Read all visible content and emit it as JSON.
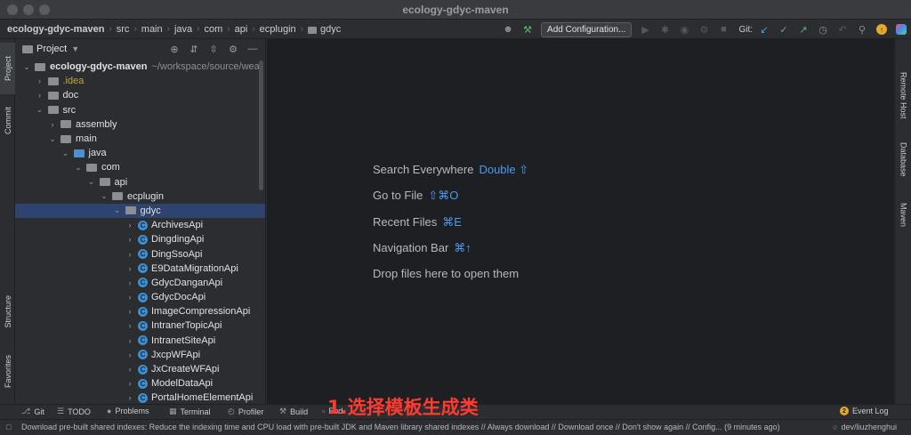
{
  "window": {
    "title": "ecology-gdyc-maven"
  },
  "breadcrumb": [
    "ecology-gdyc-maven",
    "src",
    "main",
    "java",
    "com",
    "api",
    "ecplugin",
    "gdyc"
  ],
  "toolbar": {
    "add_configuration": "Add Configuration...",
    "git_label": "Git:"
  },
  "left_tabs": {
    "project": "Project",
    "commit": "Commit",
    "structure": "Structure",
    "favorites": "Favorites"
  },
  "right_tabs": {
    "remote_host": "Remote Host",
    "database": "Database",
    "maven": "Maven"
  },
  "project_panel": {
    "title": "Project",
    "tree": [
      {
        "label": "ecology-gdyc-maven",
        "path": "~/workspace/source/wea",
        "depth": 0,
        "expanded": true,
        "kind": "module"
      },
      {
        "label": ".idea",
        "depth": 1,
        "expanded": false,
        "kind": "folder"
      },
      {
        "label": "doc",
        "depth": 1,
        "expanded": false,
        "kind": "folder"
      },
      {
        "label": "src",
        "depth": 1,
        "expanded": true,
        "kind": "folder"
      },
      {
        "label": "assembly",
        "depth": 2,
        "expanded": false,
        "kind": "folder"
      },
      {
        "label": "main",
        "depth": 2,
        "expanded": true,
        "kind": "folder"
      },
      {
        "label": "java",
        "depth": 3,
        "expanded": true,
        "kind": "source"
      },
      {
        "label": "com",
        "depth": 4,
        "expanded": true,
        "kind": "package"
      },
      {
        "label": "api",
        "depth": 5,
        "expanded": true,
        "kind": "package"
      },
      {
        "label": "ecplugin",
        "depth": 6,
        "expanded": true,
        "kind": "package"
      },
      {
        "label": "gdyc",
        "depth": 7,
        "expanded": true,
        "kind": "package",
        "selected": true
      },
      {
        "label": "ArchivesApi",
        "depth": 8,
        "expanded": false,
        "kind": "class"
      },
      {
        "label": "DingdingApi",
        "depth": 8,
        "expanded": false,
        "kind": "class"
      },
      {
        "label": "DingSsoApi",
        "depth": 8,
        "expanded": false,
        "kind": "class"
      },
      {
        "label": "E9DataMigrationApi",
        "depth": 8,
        "expanded": false,
        "kind": "class"
      },
      {
        "label": "GdycDanganApi",
        "depth": 8,
        "expanded": false,
        "kind": "class"
      },
      {
        "label": "GdycDocApi",
        "depth": 8,
        "expanded": false,
        "kind": "class"
      },
      {
        "label": "ImageCompressionApi",
        "depth": 8,
        "expanded": false,
        "kind": "class"
      },
      {
        "label": "IntranerTopicApi",
        "depth": 8,
        "expanded": false,
        "kind": "class"
      },
      {
        "label": "IntranetSiteApi",
        "depth": 8,
        "expanded": false,
        "kind": "class"
      },
      {
        "label": "JxcpWFApi",
        "depth": 8,
        "expanded": false,
        "kind": "class"
      },
      {
        "label": "JxCreateWFApi",
        "depth": 8,
        "expanded": false,
        "kind": "class"
      },
      {
        "label": "ModelDataApi",
        "depth": 8,
        "expanded": false,
        "kind": "class"
      },
      {
        "label": "PortalHomeElementApi",
        "depth": 8,
        "expanded": false,
        "kind": "class"
      }
    ]
  },
  "editor_hints": [
    {
      "text": "Search Everywhere",
      "key": "Double ⇧"
    },
    {
      "text": "Go to File",
      "key": "⇧⌘O"
    },
    {
      "text": "Recent Files",
      "key": "⌘E"
    },
    {
      "text": "Navigation Bar",
      "key": "⌘↑"
    },
    {
      "text": "Drop files here to open them",
      "key": ""
    }
  ],
  "bottom_tabs": {
    "git": "Git",
    "todo": "TODO",
    "problems": "Problems",
    "terminal": "Terminal",
    "profiler": "Profiler",
    "build": "Build",
    "endpoints": "End",
    "event_log": "Event Log",
    "event_count": "2"
  },
  "status": {
    "message": "Download pre-built shared indexes: Reduce the indexing time and CPU load with pre-built JDK and Maven library shared indexes // Always download // Download once // Don't show again // Config... (9 minutes ago)",
    "branch": "dev/liuzhenghui"
  },
  "annotation": "1.选择模板生成类",
  "colors": {
    "accent": "#4b9bf0",
    "selection": "#2e436e",
    "annotation": "#ff3b2f",
    "editor_bg": "#1e1f22",
    "panel_bg": "#2b2d30"
  }
}
